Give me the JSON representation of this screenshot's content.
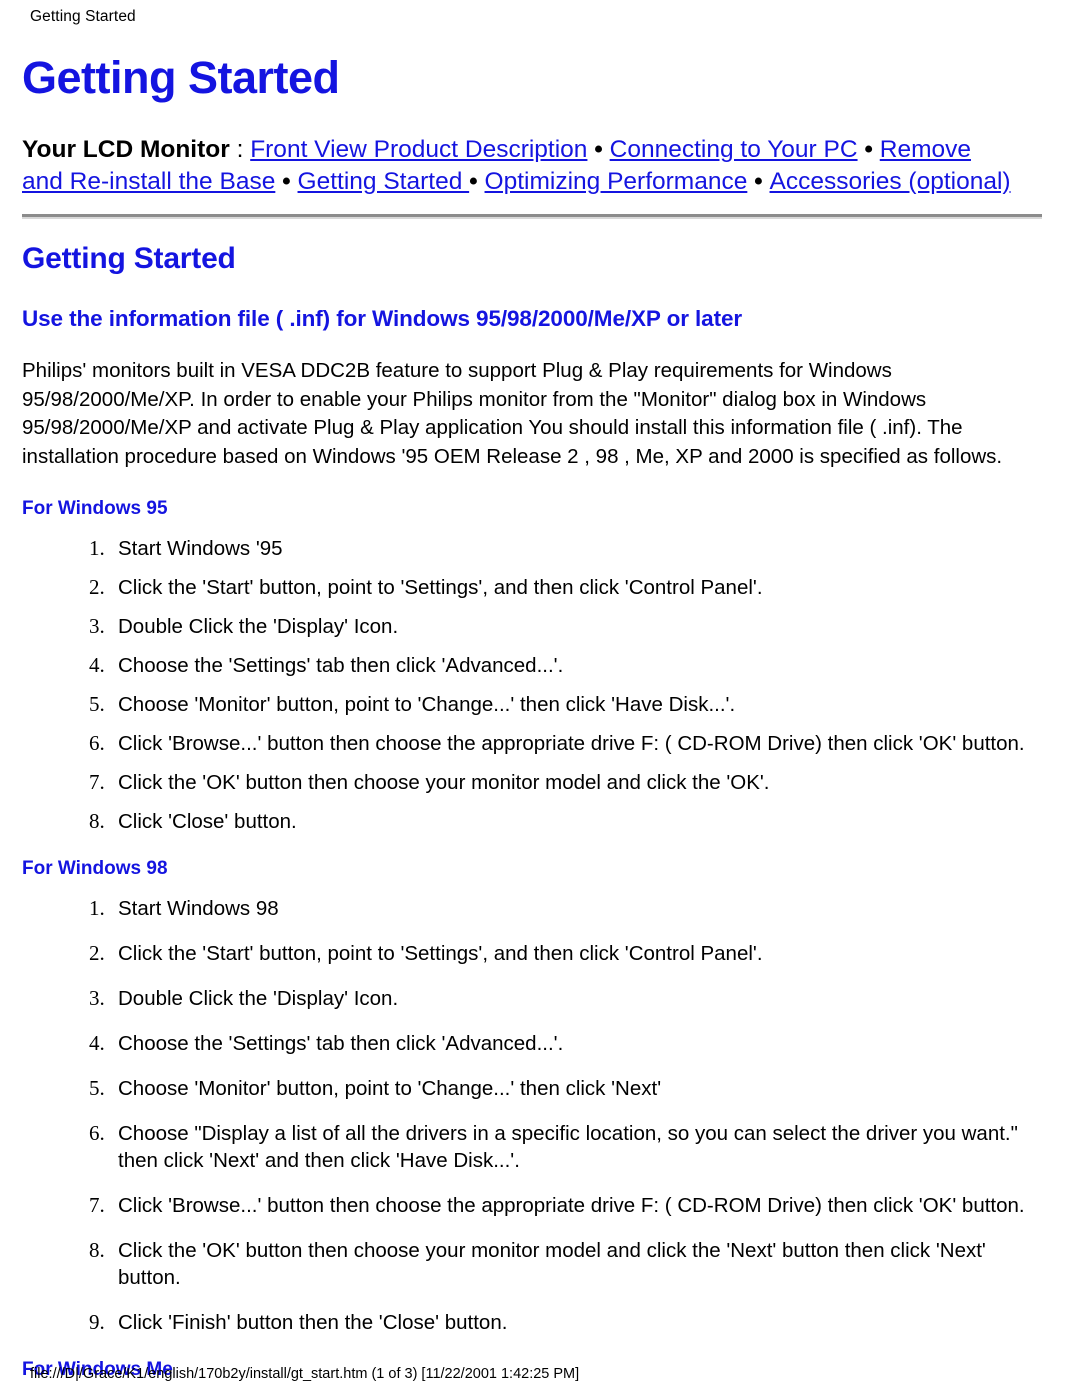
{
  "running_head": "Getting Started",
  "doc_title": "Getting Started",
  "nav": {
    "lead": "Your LCD Monitor",
    "colon": " : ",
    "separator": " • ",
    "links": [
      "Front View Product Description",
      "Connecting to Your PC",
      "Remove and Re-install the Base",
      "Getting Started ",
      "Optimizing Performance",
      "Accessories (optional)"
    ]
  },
  "section": {
    "title": "Getting Started",
    "subsection_title": "Use the information file ( .inf) for Windows 95/98/2000/Me/XP or later",
    "intro_paragraph": "Philips' monitors built in VESA DDC2B feature to support Plug & Play requirements for Windows 95/98/2000/Me/XP. In order to enable your Philips monitor from the \"Monitor\" dialog box in Windows 95/98/2000/Me/XP and activate Plug & Play application You should install this information file ( .inf). The installation procedure based on Windows '95 OEM Release 2 , 98 , Me, XP and 2000 is specified as follows."
  },
  "os_groups": [
    {
      "heading": "For Windows 95",
      "steps": [
        "Start Windows '95",
        "Click the 'Start' button, point to 'Settings', and then click 'Control Panel'.",
        "Double Click the 'Display' Icon.",
        "Choose the 'Settings' tab then click 'Advanced...'.",
        "Choose 'Monitor' button, point to 'Change...' then click 'Have Disk...'.",
        "Click 'Browse...' button then choose the appropriate drive F: ( CD-ROM Drive) then click 'OK' button.",
        "Click the 'OK' button then choose your monitor model and click the 'OK'.",
        "Click 'Close' button."
      ]
    },
    {
      "heading": "For Windows 98",
      "steps": [
        "Start Windows 98",
        "Click the 'Start' button, point to 'Settings', and then click 'Control Panel'.",
        "Double Click the 'Display' Icon.",
        "Choose the 'Settings' tab then click 'Advanced...'.",
        "Choose 'Monitor' button, point to 'Change...' then click 'Next'",
        "Choose \"Display a list of all the drivers in a specific location, so you can select the driver you want.\" then click 'Next' and then click 'Have Disk...'.",
        "Click 'Browse...' button then choose the appropriate drive F: ( CD-ROM Drive) then click 'OK' button.",
        "Click the 'OK' button then choose your monitor model and click the 'Next' button then click 'Next' button.",
        "Click 'Finish' button then the 'Close' button."
      ]
    },
    {
      "heading": "For Windows Me",
      "steps": []
    }
  ],
  "footer": "file:///D|/Grace/K1/english/170b2y/install/gt_start.htm (1 of 3) [11/22/2001 1:42:25 PM]",
  "colors": {
    "link_blue": "#1414E0",
    "heading_blue": "#1414E0",
    "text_black": "#000000",
    "rule_dark": "#8c8c8c",
    "rule_light": "#d8d8d8",
    "page_background": "#ffffff"
  }
}
